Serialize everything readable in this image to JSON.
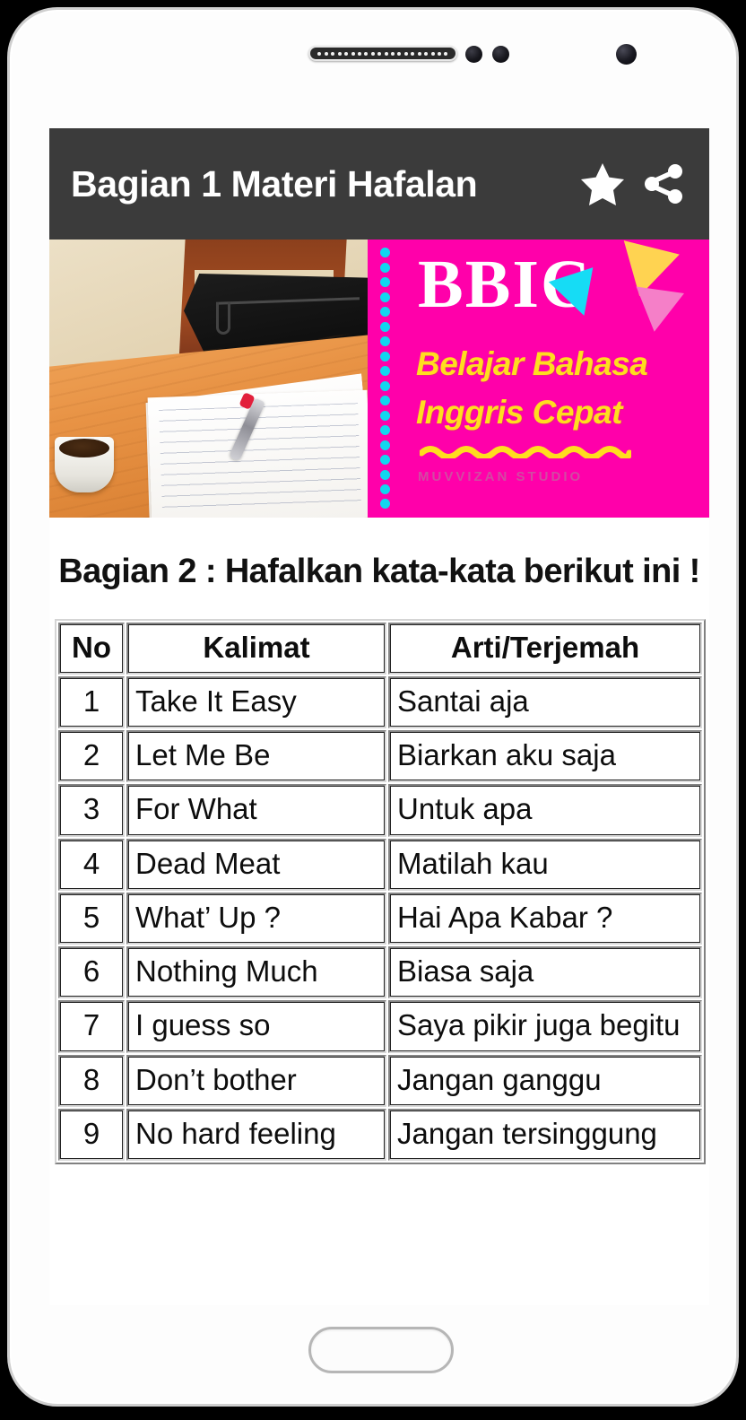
{
  "app": {
    "title": "Bagian 1 Materi Hafalan",
    "bar_color": "#3b3b3b",
    "favorite_icon": "star-icon",
    "share_icon": "share-icon"
  },
  "banner": {
    "photo_alt": "desk-photo",
    "brand": "BBIC",
    "tagline_line1": "Belajar Bahasa",
    "tagline_line2": "Inggris Cepat",
    "studio_credit": "MUVVIZAN STUDIO",
    "background_color": "#ff00aa",
    "brand_color": "#ffffff",
    "tagline_color": "#ffdd1f",
    "dot_color": "#11d6ef",
    "triangle_colors": [
      "#ffd351",
      "#16dcf5",
      "#f57fc8"
    ]
  },
  "content": {
    "heading": "Bagian 2 : Hafalkan kata-kata berikut ini !"
  },
  "table": {
    "headers": [
      "No",
      "Kalimat",
      "Arti/Terjemah"
    ],
    "rows": [
      {
        "no": "1",
        "kalimat": "Take It Easy",
        "arti": "Santai aja"
      },
      {
        "no": "2",
        "kalimat": "Let Me Be",
        "arti": "Biarkan aku saja"
      },
      {
        "no": "3",
        "kalimat": "For What",
        "arti": "Untuk apa"
      },
      {
        "no": "4",
        "kalimat": "Dead Meat",
        "arti": "Matilah kau"
      },
      {
        "no": "5",
        "kalimat": "What’ Up ?",
        "arti": "Hai Apa Kabar ?"
      },
      {
        "no": "6",
        "kalimat": "Nothing Much",
        "arti": "Biasa saja"
      },
      {
        "no": "7",
        "kalimat": "I guess so",
        "arti": "Saya pikir juga begitu"
      },
      {
        "no": "8",
        "kalimat": "Don’t bother",
        "arti": "Jangan ganggu"
      },
      {
        "no": "9",
        "kalimat": "No hard feeling",
        "arti": "Jangan tersinggung"
      }
    ]
  },
  "device": {
    "speaker_icon": "speaker-grille-icon",
    "camera_icon": "front-camera-icon",
    "home_button": "home-button"
  }
}
